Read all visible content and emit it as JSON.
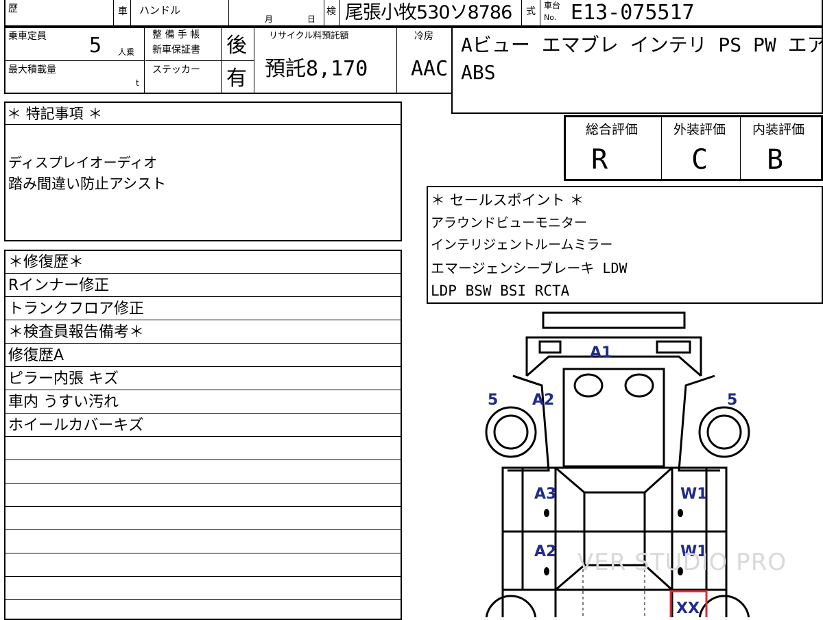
{
  "header": {
    "history_label": "歴",
    "car_label": "車",
    "handle_label": "ハンドル",
    "month_label": "月",
    "day_label": "日",
    "inspection_label": "検",
    "plate": "尾張小牧530ソ8786",
    "model_label": "式",
    "chassis_label_top": "車台",
    "chassis_label_bottom": "No.",
    "chassis_number": "E13-075517"
  },
  "info": {
    "capacity_label": "乗車定員",
    "capacity_value": "5",
    "capacity_unit": "人乗",
    "maintenance_label_1": "整 備 手 帳",
    "maintenance_label_2": "新車保証書",
    "maintenance_value": "後",
    "sticker_label": "ステッカー",
    "sticker_value": "有",
    "max_load_label": "最大積載量",
    "max_load_unit": "t",
    "recycle_label": "リサイクル料預託額",
    "recycle_value": "預託8,170",
    "aircon_label": "冷房",
    "aircon_value": "AAC"
  },
  "equipment": {
    "line1": "Aビュー エマブレ インテリ PS PW エアB",
    "line2": "ABS"
  },
  "ratings": {
    "overall_label": "総合評価",
    "overall_value": "R",
    "exterior_label": "外装評価",
    "exterior_value": "C",
    "interior_label": "内装評価",
    "interior_value": "B"
  },
  "special_notes": {
    "title": "＊ 特記事項 ＊",
    "lines": [
      "ディスプレイオーディオ",
      "踏み間違い防止アシスト"
    ]
  },
  "sales_points": {
    "title": "＊ セールスポイント ＊",
    "lines": [
      "アラウンドビューモニター",
      "インテリジェントルームミラー",
      "エマージェンシーブレーキ LDW",
      "LDP BSW BSI RCTA"
    ]
  },
  "repair": {
    "rows": [
      "＊修復歴＊",
      "Rインナー修正",
      "トランクフロア修正",
      "＊検査員報告備考＊",
      "修復歴A",
      "ピラー内張 キズ",
      "車内 うすい汚れ",
      "ホイールカバーキズ"
    ]
  },
  "diagram": {
    "marks": [
      "A1",
      "A2",
      "5",
      "5",
      "A3",
      "W1",
      "A2",
      "W1",
      "XX"
    ],
    "mark_color": "#1f2a8a",
    "alert_color": "#d9303a"
  },
  "watermark": "VER STUDIO PRO"
}
